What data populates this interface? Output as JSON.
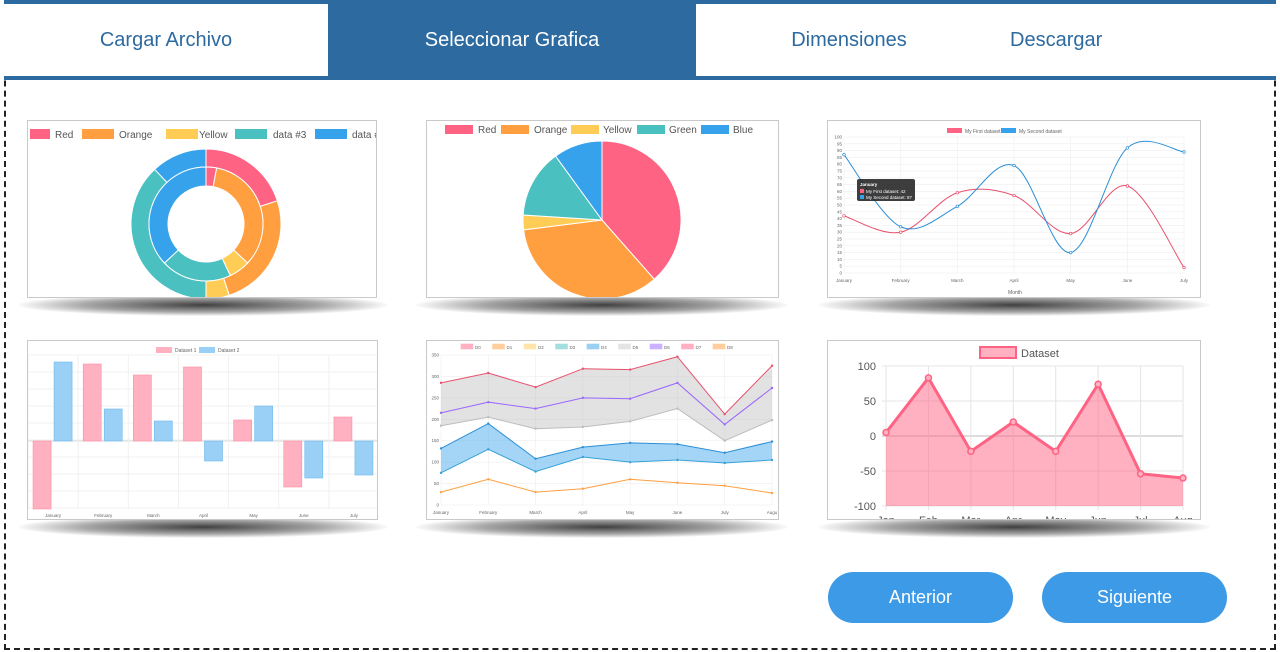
{
  "tabs": [
    {
      "label": "Cargar Archivo",
      "active": false
    },
    {
      "label": "Seleccionar Grafica",
      "active": true
    },
    {
      "label": "Dimensiones",
      "active": false
    },
    {
      "label": "Descargar",
      "active": false
    }
  ],
  "colors": {
    "accent": "#2c6aa0",
    "button": "#3c9ae6",
    "red": "#ff6384",
    "orange": "#ff9f40",
    "yellow": "#ffcd56",
    "teal": "#4bc0c0",
    "blue": "#36a2eb"
  },
  "thumbnails": [
    {
      "name": "doughnut",
      "legend": [
        "Red",
        "Orange",
        "Yellow",
        "data #3",
        "data #"
      ]
    },
    {
      "name": "pie",
      "legend": [
        "Red",
        "Orange",
        "Yellow",
        "Green",
        "Blue"
      ]
    },
    {
      "name": "line-tooltip",
      "legend": [
        "My First dataset",
        "My Second dataset"
      ],
      "y_ticks": [
        "100",
        "95",
        "90",
        "85",
        "80",
        "75",
        "70",
        "65",
        "60",
        "55",
        "50",
        "45",
        "40",
        "35",
        "30",
        "25",
        "20",
        "15",
        "10",
        "5",
        "0"
      ],
      "x_labels": [
        "January",
        "February",
        "March",
        "April",
        "May",
        "June",
        "July"
      ],
      "x_title": "Month",
      "tooltip": {
        "title": "January",
        "lines": [
          "My First dataset: 42",
          "My Second dataset: 87"
        ]
      }
    },
    {
      "name": "bar-negative",
      "legend": [
        "Dataset 1",
        "Dataset 2"
      ],
      "x_labels": [
        "January",
        "February",
        "March",
        "April",
        "May",
        "June",
        "July"
      ]
    },
    {
      "name": "stacked-area",
      "legend": [
        "D0",
        "D1",
        "D2",
        "D3",
        "D4",
        "D5",
        "D6",
        "D7",
        "D8"
      ],
      "y_ticks": [
        "350",
        "300",
        "250",
        "200",
        "150",
        "100",
        "50",
        "0"
      ],
      "x_labels": [
        "January",
        "February",
        "March",
        "April",
        "May",
        "June",
        "July",
        "Augu"
      ]
    },
    {
      "name": "area-dataset",
      "legend": [
        "Dataset"
      ],
      "y_ticks": [
        "100",
        "50",
        "0",
        "-50",
        "-100"
      ],
      "x_labels": [
        "Jan",
        "Feb",
        "Mar",
        "Apr",
        "May",
        "Jun",
        "Jul",
        "Aug"
      ]
    }
  ],
  "buttons": {
    "prev": "Anterior",
    "next": "Siguiente"
  }
}
